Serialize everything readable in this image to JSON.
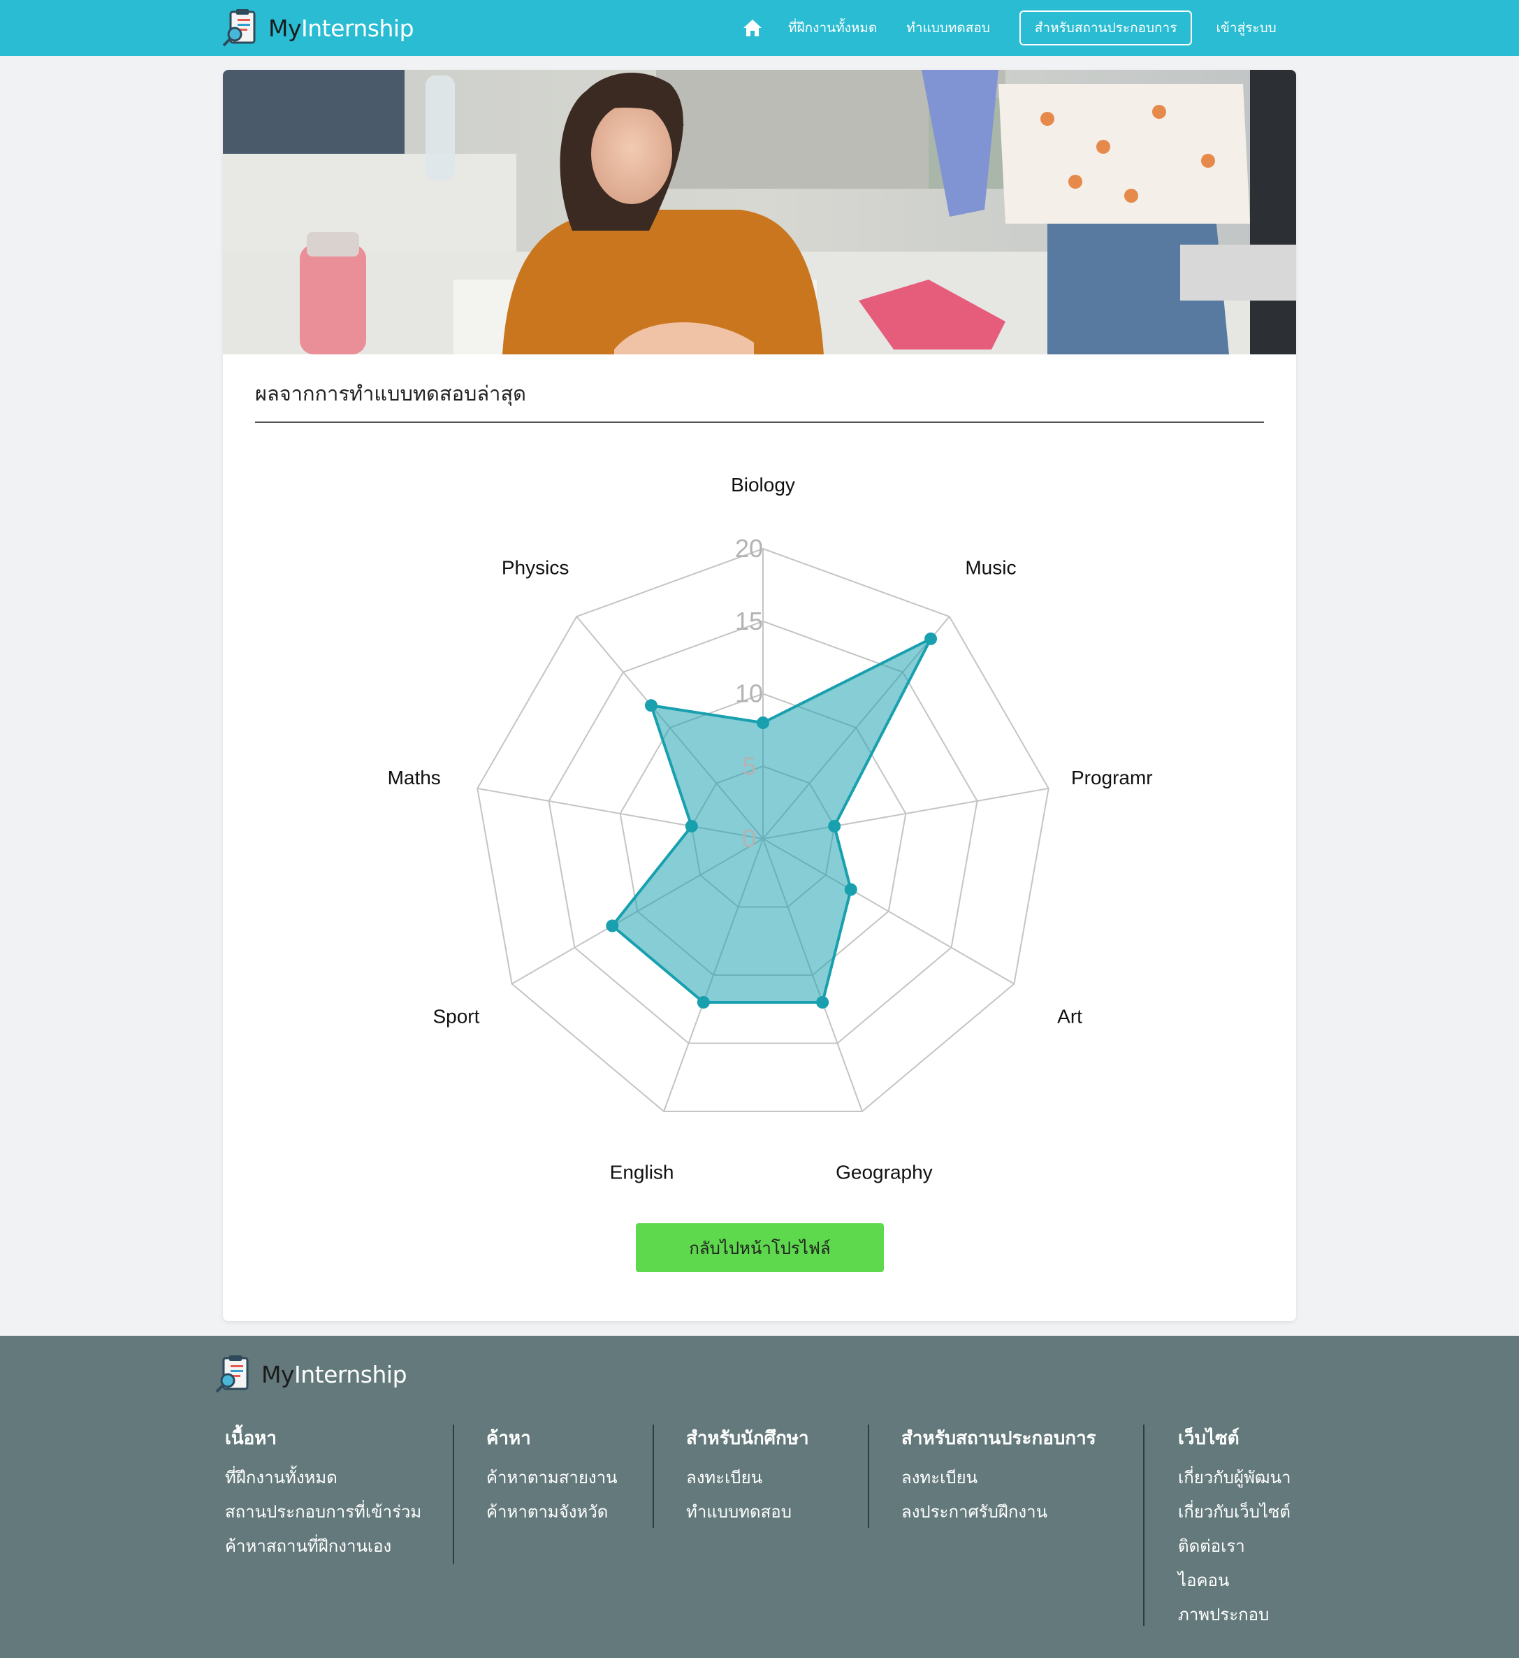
{
  "brand": {
    "my": "My",
    "internship": "Internship"
  },
  "nav": {
    "home_icon": "home-icon",
    "items": [
      "ที่ฝึกงานทั้งหมด",
      "ทำแบบทดสอบ",
      "สำหรับสถานประกอบการ",
      "เข้าสู่ระบบ"
    ]
  },
  "colors": {
    "nav_bg": "#29bcd2",
    "footer_bg": "#63797b",
    "radar_fill": "#18a0af",
    "button": "#5ed84c"
  },
  "main": {
    "title": "ผลจากการทำแบบทดสอบล่าสุด",
    "back_button": "กลับไปหน้าโปรไฟล์"
  },
  "chart_data": {
    "type": "radar",
    "axes": [
      "Biology",
      "Music",
      "Programr",
      "Art",
      "Geography",
      "English",
      "Sport",
      "Maths",
      "Physics"
    ],
    "ticks": [
      "0",
      "5",
      "10",
      "15",
      "20"
    ],
    "range": [
      0,
      20
    ],
    "series": [
      {
        "values": [
          8,
          18,
          5,
          7,
          12,
          12,
          12,
          5,
          12
        ]
      }
    ]
  },
  "footer": {
    "columns": [
      {
        "title": "เนื้อหา",
        "links": [
          "ที่ฝึกงานทั้งหมด",
          "สถานประกอบการที่เข้าร่วม",
          "ค้าหาสถานที่ฝึกงานเอง"
        ]
      },
      {
        "title": "ค้าหา",
        "links": [
          "ค้าหาตามสายงาน",
          "ค้าหาตามจังหวัด"
        ]
      },
      {
        "title": "สำหรับนักศึกษา",
        "links": [
          "ลงทะเบียน",
          "ทำแบบทดสอบ"
        ]
      },
      {
        "title": "สำหรับสถานประกอบการ",
        "links": [
          "ลงทะเบียน",
          "ลงประกาศรับฝึกงาน"
        ]
      },
      {
        "title": "เว็บไซต์",
        "links": [
          "เกี่ยวกับผู้พัฒนา",
          "เกี่ยวกับเว็บไซต์",
          "ติดต่อเรา",
          "ไอคอน",
          "ภาพประกอบ"
        ]
      }
    ]
  }
}
